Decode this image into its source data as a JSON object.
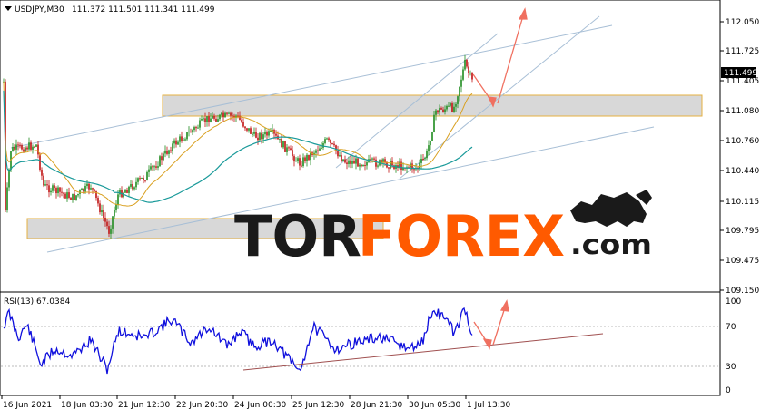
{
  "main_pane": {
    "symbol_header": "USDJPY,M30",
    "ohlc_values": "111.372 111.501 111.341 111.499",
    "price_axis_ticks": [
      "112.050",
      "111.725",
      "111.405",
      "111.080",
      "110.760",
      "110.440",
      "110.115",
      "109.795",
      "109.475",
      "109.150"
    ],
    "current_price_label": "111.499"
  },
  "rsi_pane": {
    "header": "RSI(13) 67.0384",
    "level_ticks": [
      "100",
      "70",
      "30",
      "0"
    ]
  },
  "time_axis": {
    "labels": [
      "16 Jun 2021",
      "18 Jun 03:30",
      "21 Jun 12:30",
      "22 Jun 20:30",
      "24 Jun 00:30",
      "25 Jun 12:30",
      "28 Jun 21:30",
      "30 Jun 05:30",
      "1 Jul 13:30"
    ]
  },
  "watermark": {
    "part1": "TOR",
    "part2": "FOREX",
    "part3": ".com"
  },
  "colors": {
    "bull_candle": "#1e8b1e",
    "bear_candle": "#c01010",
    "ma_slow": "#1a9a9a",
    "ma_fast": "#d9a020",
    "rsi_line": "#1010dd",
    "trend_lines": "#a8bfd6",
    "support_zone": "#d8d8d8",
    "zone_border": "#e6b040",
    "forecast_arrow": "#f07060",
    "rsi_trend": "#a05050",
    "brand_black": "#1a1a1a",
    "brand_orange": "#ff5a00"
  }
}
